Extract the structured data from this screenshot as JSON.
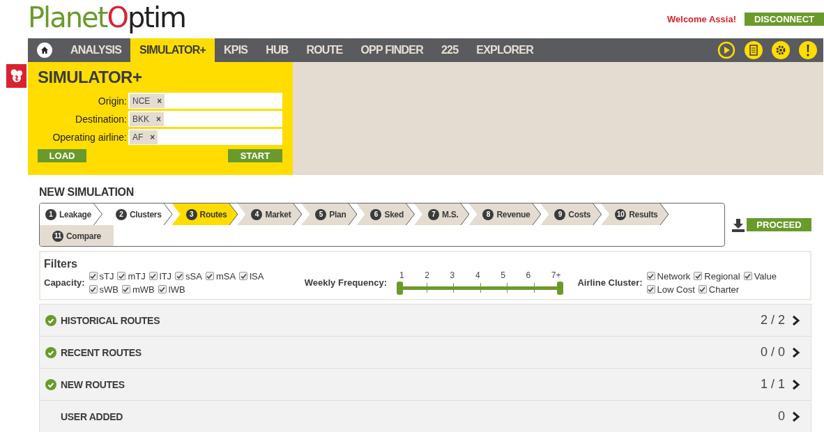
{
  "header": {
    "logo": {
      "part_1": "Planet",
      "part_2": "O",
      "part_3": "ptim"
    },
    "welcome": "Welcome Assia!",
    "disconnect": "DISCONNECT"
  },
  "nav": {
    "items": [
      {
        "label": "ANALYSIS",
        "selected": false
      },
      {
        "label": "SIMULATOR+",
        "selected": true
      },
      {
        "label": "KPIS",
        "selected": false
      },
      {
        "label": "HUB",
        "selected": false
      },
      {
        "label": "ROUTE",
        "selected": false
      },
      {
        "label": "OPP FINDER",
        "selected": false
      },
      {
        "label": "225",
        "selected": false
      },
      {
        "label": "EXPLORER",
        "selected": false
      }
    ]
  },
  "simulator": {
    "title": "SIMULATOR+",
    "fields": [
      {
        "label": "Origin:",
        "token": "NCE",
        "remove": "×"
      },
      {
        "label": "Destination:",
        "token": "BKK",
        "remove": "×"
      },
      {
        "label": "Operating airline:",
        "token": "AF",
        "remove": "×"
      }
    ],
    "load": "LOAD",
    "start": "START"
  },
  "simulation": {
    "title": "NEW SIMULATION",
    "steps": [
      {
        "kind": "chevron",
        "number": "1",
        "label": "Leakage",
        "done": true,
        "selected": false
      },
      {
        "kind": "chevron",
        "number": "2",
        "label": "Clusters",
        "done": true,
        "selected": false
      },
      {
        "kind": "chevron",
        "number": "3",
        "label": "Routes",
        "done": false,
        "selected": true
      },
      {
        "kind": "chevron",
        "number": "4",
        "label": "Market",
        "done": false,
        "selected": false
      },
      {
        "kind": "chevron",
        "number": "5",
        "label": "Plan",
        "done": false,
        "selected": false
      },
      {
        "kind": "chevron",
        "number": "6",
        "label": "Sked",
        "done": false,
        "selected": false
      },
      {
        "kind": "chevron",
        "number": "7",
        "label": "M.S.",
        "done": false,
        "selected": false
      },
      {
        "kind": "chevron",
        "number": "8",
        "label": "Revenue",
        "done": false,
        "selected": false
      },
      {
        "kind": "chevron",
        "number": "9",
        "label": "Costs",
        "done": false,
        "selected": false
      },
      {
        "kind": "chevron",
        "number": "10",
        "label": "Results",
        "done": false,
        "selected": false
      },
      {
        "kind": "tab",
        "number": "11",
        "label": "Compare",
        "done": false,
        "selected": false
      }
    ],
    "proceed": "PROCEED"
  },
  "filters": {
    "title": "Filters",
    "capacity": {
      "label": "Capacity:",
      "options": [
        {
          "label": "sTJ",
          "checked": true
        },
        {
          "label": "mTJ",
          "checked": true
        },
        {
          "label": "lTJ",
          "checked": true
        },
        {
          "label": "sSA",
          "checked": true
        },
        {
          "label": "mSA",
          "checked": true
        },
        {
          "label": "lSA",
          "checked": true
        },
        {
          "label": "sWB",
          "checked": true
        },
        {
          "label": "mWB",
          "checked": true
        },
        {
          "label": "lWB",
          "checked": true
        }
      ]
    },
    "frequency": {
      "label": "Weekly Frequency:",
      "ticks": [
        "1",
        "2",
        "3",
        "4",
        "5",
        "6",
        "7+"
      ],
      "level": 1
    },
    "cluster": {
      "label": "Airline Cluster:",
      "options": [
        {
          "label": "Network",
          "checked": true
        },
        {
          "label": "Regional",
          "checked": true
        },
        {
          "label": "Value",
          "checked": true
        },
        {
          "label": "Low Cost",
          "checked": true
        },
        {
          "label": "Charter",
          "checked": true
        }
      ]
    }
  },
  "route_groups": [
    {
      "label": "HISTORICAL ROUTES",
      "complete": true,
      "count": "2 / 2"
    },
    {
      "label": "RECENT ROUTES",
      "complete": true,
      "count": "0 / 0"
    },
    {
      "label": "NEW ROUTES",
      "complete": true,
      "count": "1 / 1"
    },
    {
      "label": "USER ADDED",
      "complete": false,
      "count": "0"
    }
  ]
}
